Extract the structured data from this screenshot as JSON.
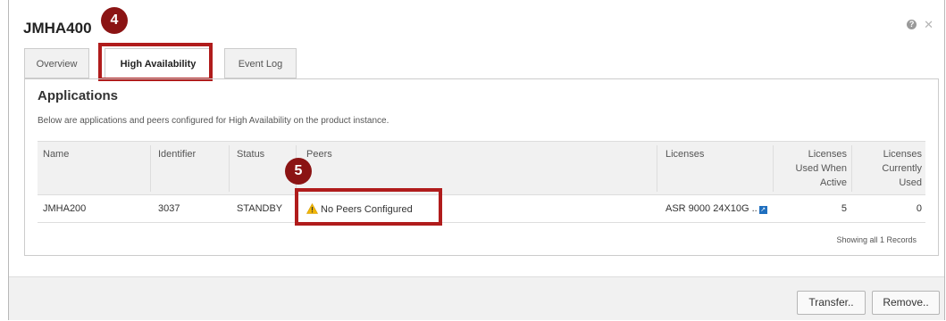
{
  "dialog": {
    "title": "JMHA400",
    "help_glyph": "?",
    "close_glyph": "✕"
  },
  "callouts": {
    "tab_marker": "4",
    "peers_marker": "5"
  },
  "tabs": [
    {
      "label": "Overview"
    },
    {
      "label": "High Availability",
      "active": true
    },
    {
      "label": "Event Log"
    }
  ],
  "section": {
    "title": "Applications",
    "description": "Below are applications and peers configured for High Availability on the product instance."
  },
  "table": {
    "headers": {
      "name": "Name",
      "identifier": "Identifier",
      "status": "Status",
      "peers": "Peers",
      "licenses": "Licenses",
      "used_active_1": "Licenses",
      "used_active_2": "Used When",
      "used_active_3": "Active",
      "currently_1": "Licenses",
      "currently_2": "Currently",
      "currently_3": "Used"
    },
    "rows": [
      {
        "name": "JMHA200",
        "identifier": "3037",
        "status": "STANDBY",
        "peers": "No Peers Configured",
        "licenses": "ASR 9000 24X10G ..",
        "used_when_active": "5",
        "currently_used": "0"
      }
    ],
    "records_text": "Showing all 1 Records"
  },
  "footer": {
    "transfer_label": "Transfer..",
    "remove_label": "Remove.."
  },
  "colors": {
    "callout": "#8b1414",
    "highlight": "#b01c1c",
    "warning": "#f2b705",
    "link": "#1f6fbf"
  }
}
